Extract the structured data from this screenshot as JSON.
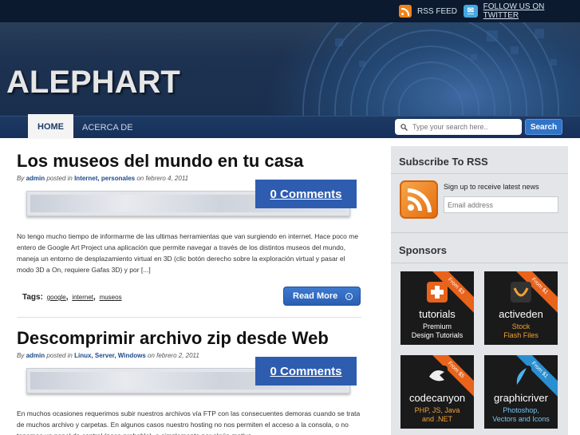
{
  "topbar": {
    "rss_label": "RSS FEED",
    "twitter_label": "FOLLOW US ON TWITTER"
  },
  "site": {
    "logo": "ALEPHART"
  },
  "nav": {
    "items": [
      {
        "label": "HOME"
      },
      {
        "label": "ACERCA DE"
      }
    ],
    "search_placeholder": "Type your search here..",
    "search_button": "Search"
  },
  "posts": [
    {
      "title": "Los museos del mundo en tu casa",
      "by": "By",
      "author": "admin",
      "posted_in": "posted in",
      "categories": "Internet, personales",
      "on": "on febrero 4, 2011",
      "comments": "0 Comments",
      "excerpt": "No tengo mucho tiempo de informarme de las ultimas herramientas que van surgiendo en internet. Hace poco me entero de Google Art Project una aplicación que permite navegar a través de los distintos museos del mundo, maneja un entorno de desplazamiento virtual en 3D (clic botón derecho sobre la exploración virtual y pasar el modo 3D a On, requiere Gafas 3D) y por [...]",
      "tags_label": "Tags:",
      "tags": [
        "google",
        "internet",
        "museos"
      ],
      "read_more": "Read More"
    },
    {
      "title": "Descomprimir archivo zip desde Web",
      "by": "By",
      "author": "admin",
      "posted_in": "posted in",
      "categories": "Linux, Server, Windows",
      "on": "on febrero 2, 2011",
      "comments": "0 Comments",
      "excerpt": "En muchos ocasiones requerimos subir nuestros archivos vía FTP con las consecuentes demoras cuando se trata de muchos archivo y carpetas. En algunos casos nuestro hosting no nos permiten el acceso a la consola, o no tenemos un panel de control (poco probable), o simplemente por algún motivo"
    }
  ],
  "sidebar": {
    "subscribe_title": "Subscribe To RSS",
    "signup_text": "Sign up to receive latest news",
    "email_placeholder": "Email address",
    "sponsors_title": "Sponsors",
    "sponsors": [
      {
        "brand": "tutorials",
        "line1": "Premium",
        "line2": "Design Tutorials",
        "badge": "From $3",
        "accent": "#e8631b",
        "sub_color": "#ffffff"
      },
      {
        "brand": "activeden",
        "line1": "Stock",
        "line2": "Flash Files",
        "badge": "From $1",
        "accent": "#e8631b",
        "sub_color": "#f2a233"
      },
      {
        "brand": "codecanyon",
        "line1": "PHP, JS, Java",
        "line2": "and .NET",
        "badge": "From $5",
        "accent": "#e8631b",
        "sub_color": "#f2a233"
      },
      {
        "brand": "graphicriver",
        "line1": "Photoshop,",
        "line2": "Vectors and Icons",
        "badge": "From $1",
        "accent": "#2a8fd0",
        "sub_color": "#7cc3f0"
      }
    ]
  }
}
